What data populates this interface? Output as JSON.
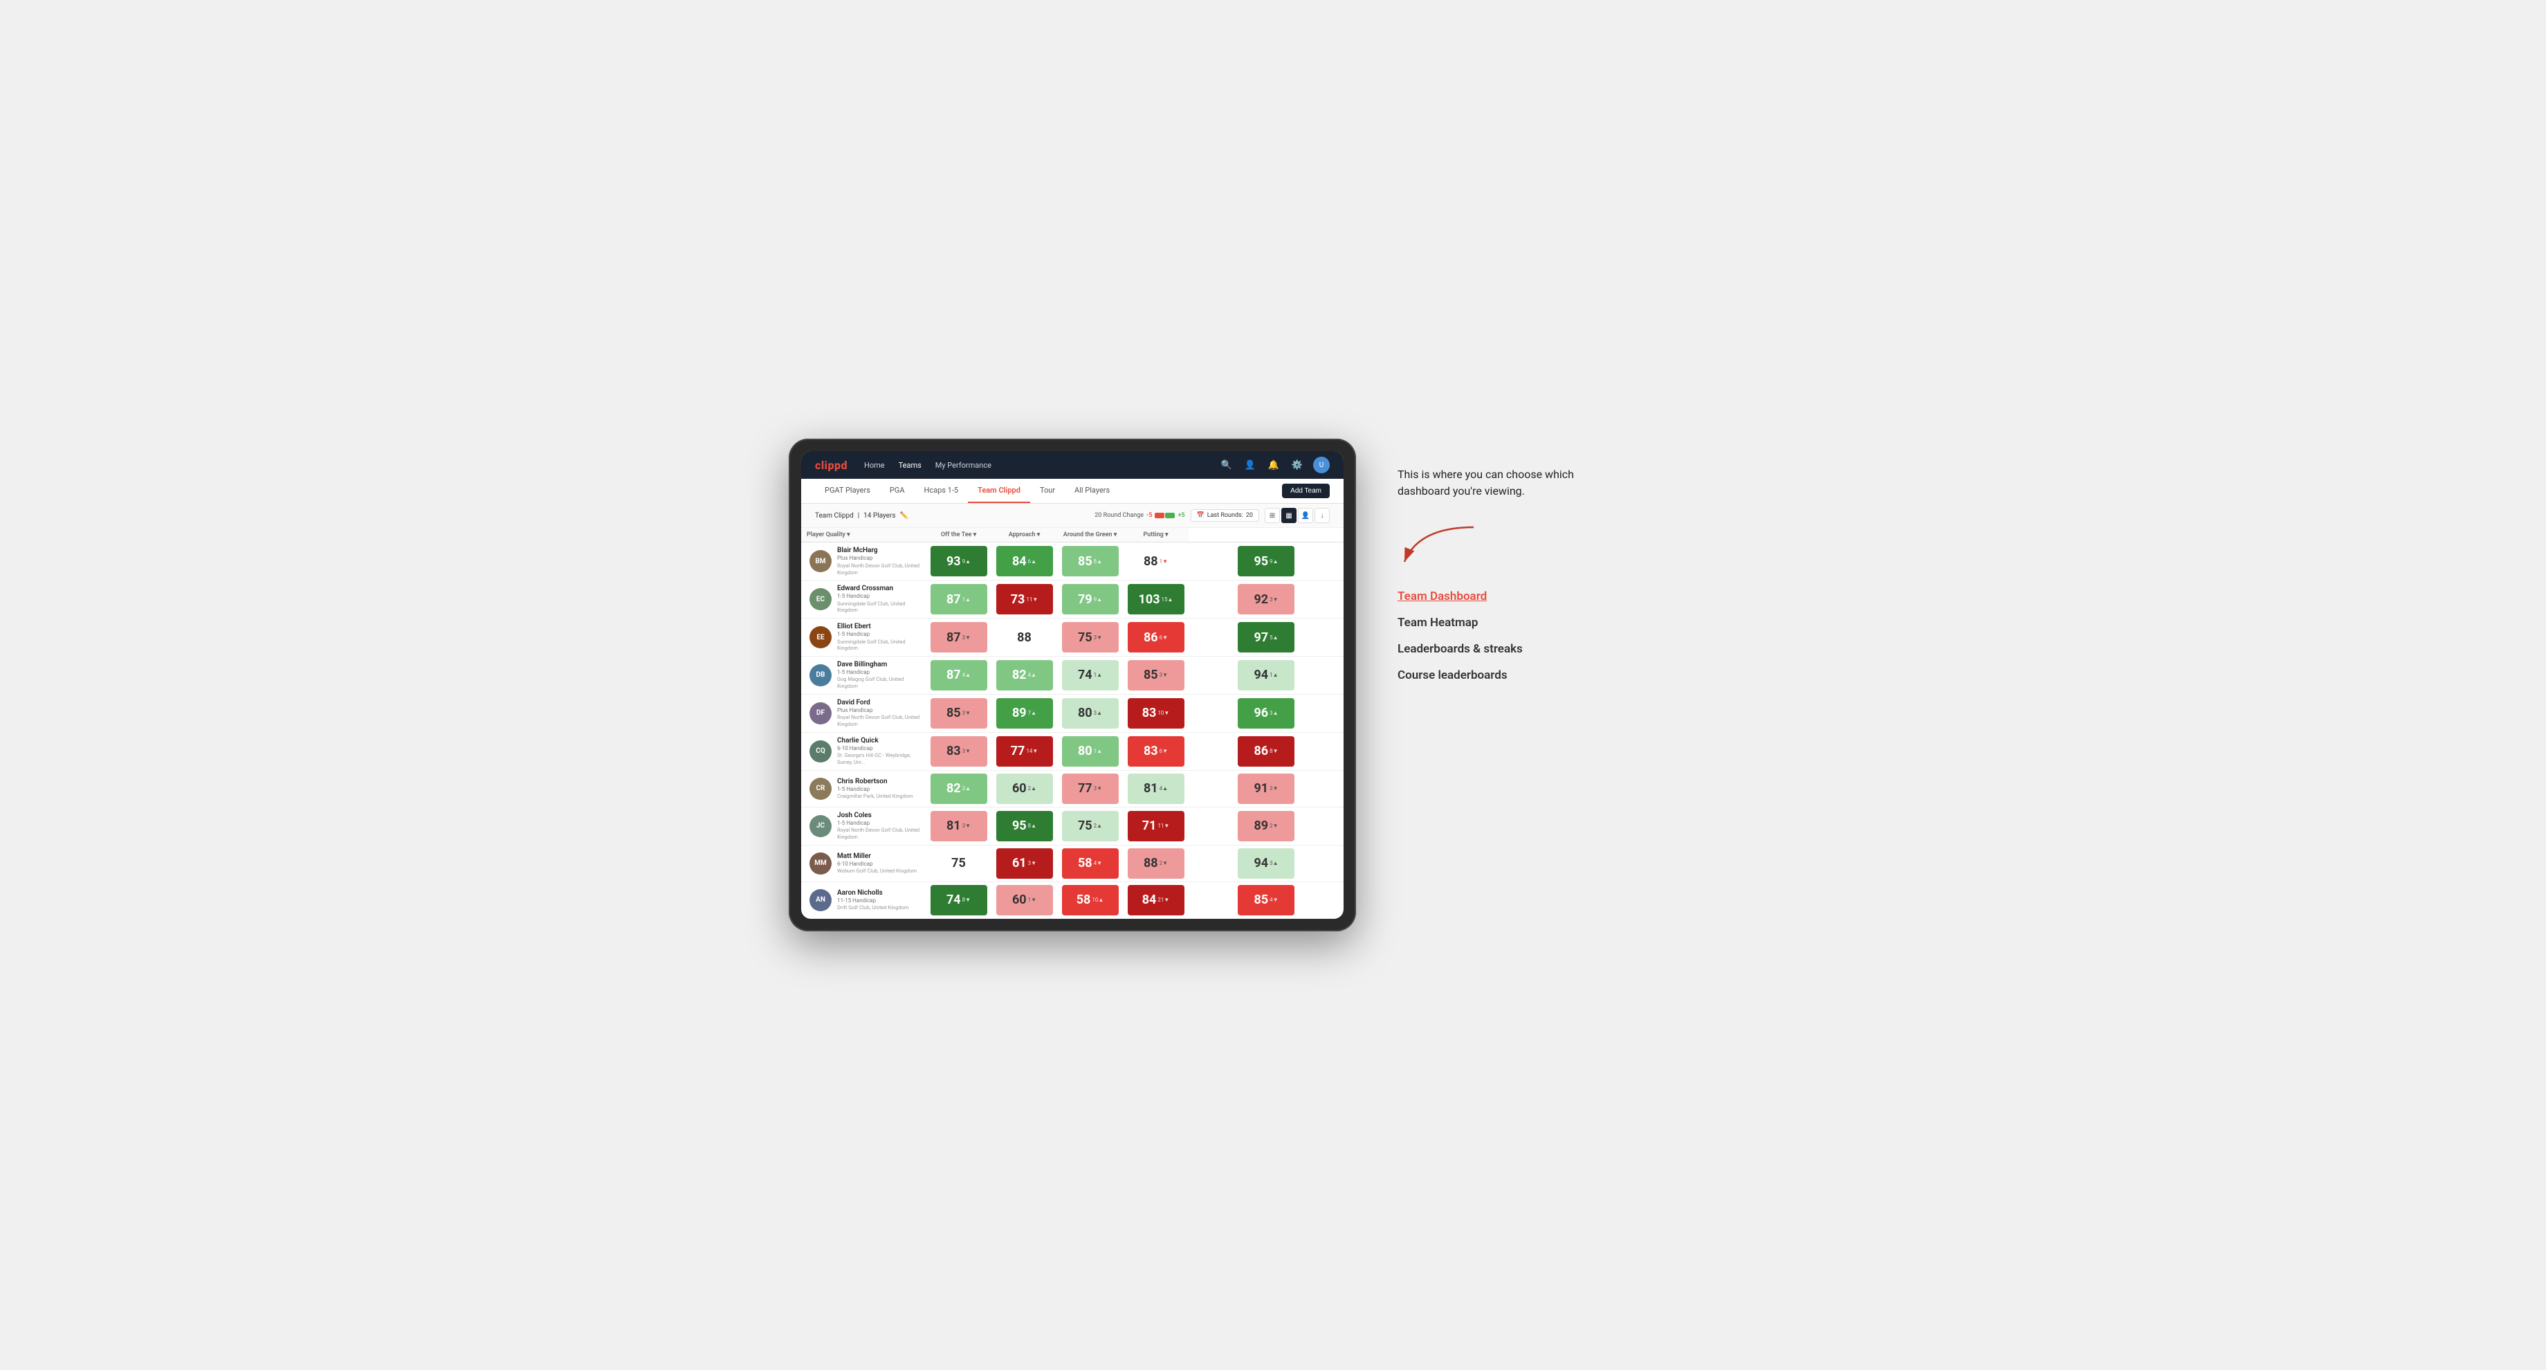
{
  "annotation": {
    "intro_text": "This is where you can choose which dashboard you're viewing.",
    "options": [
      {
        "id": "team-dashboard",
        "label": "Team Dashboard",
        "active": true
      },
      {
        "id": "team-heatmap",
        "label": "Team Heatmap",
        "active": false
      },
      {
        "id": "leaderboards",
        "label": "Leaderboards & streaks",
        "active": false
      },
      {
        "id": "course-leaderboards",
        "label": "Course leaderboards",
        "active": false
      }
    ]
  },
  "nav": {
    "logo": "clippd",
    "links": [
      {
        "id": "home",
        "label": "Home",
        "active": false
      },
      {
        "id": "teams",
        "label": "Teams",
        "active": true
      },
      {
        "id": "my-performance",
        "label": "My Performance",
        "active": false
      }
    ]
  },
  "sub_nav": {
    "tabs": [
      {
        "id": "pgat",
        "label": "PGAT Players",
        "active": false
      },
      {
        "id": "pga",
        "label": "PGA",
        "active": false
      },
      {
        "id": "hcaps",
        "label": "Hcaps 1-5",
        "active": false
      },
      {
        "id": "team-clippd",
        "label": "Team Clippd",
        "active": true
      },
      {
        "id": "tour",
        "label": "Tour",
        "active": false
      },
      {
        "id": "all-players",
        "label": "All Players",
        "active": false
      }
    ],
    "add_team_btn": "Add Team"
  },
  "team_header": {
    "team_name": "Team Clippd",
    "player_count": "14 Players",
    "round_change_label": "20 Round Change",
    "minus_5": "-5",
    "plus_5": "+5",
    "last_rounds_label": "Last Rounds:",
    "last_rounds_value": "20"
  },
  "table": {
    "col_headers": [
      {
        "id": "player-quality",
        "label": "Player Quality ▾"
      },
      {
        "id": "off-tee",
        "label": "Off the Tee ▾"
      },
      {
        "id": "approach",
        "label": "Approach ▾"
      },
      {
        "id": "around-green",
        "label": "Around the Green ▾"
      },
      {
        "id": "putting",
        "label": "Putting ▾"
      }
    ],
    "players": [
      {
        "id": "blair-mcharg",
        "name": "Blair McHarg",
        "handicap": "Plus Handicap",
        "club": "Royal North Devon Golf Club, United Kingdom",
        "avatar_initials": "BM",
        "avatar_color": "#8B7355",
        "scores": [
          {
            "value": "93",
            "change": "9",
            "direction": "up",
            "bg": "strong-green"
          },
          {
            "value": "84",
            "change": "6",
            "direction": "up",
            "bg": "med-green"
          },
          {
            "value": "85",
            "change": "8",
            "direction": "up",
            "bg": "light-green"
          },
          {
            "value": "88",
            "change": "1",
            "direction": "down",
            "bg": "white"
          },
          {
            "value": "95",
            "change": "9",
            "direction": "up",
            "bg": "strong-green"
          }
        ]
      },
      {
        "id": "edward-crossman",
        "name": "Edward Crossman",
        "handicap": "1-5 Handicap",
        "club": "Sunningdale Golf Club, United Kingdom",
        "avatar_initials": "EC",
        "avatar_color": "#6B8E6B",
        "scores": [
          {
            "value": "87",
            "change": "1",
            "direction": "up",
            "bg": "light-green"
          },
          {
            "value": "73",
            "change": "11",
            "direction": "down",
            "bg": "strong-red"
          },
          {
            "value": "79",
            "change": "9",
            "direction": "up",
            "bg": "light-green"
          },
          {
            "value": "103",
            "change": "15",
            "direction": "up",
            "bg": "strong-green"
          },
          {
            "value": "92",
            "change": "3",
            "direction": "down",
            "bg": "light-red"
          }
        ]
      },
      {
        "id": "elliot-ebert",
        "name": "Elliot Ebert",
        "handicap": "1-5 Handicap",
        "club": "Sunningdale Golf Club, United Kingdom",
        "avatar_initials": "EE",
        "avatar_color": "#8B4513",
        "scores": [
          {
            "value": "87",
            "change": "3",
            "direction": "down",
            "bg": "light-red"
          },
          {
            "value": "88",
            "change": "",
            "direction": "",
            "bg": "white"
          },
          {
            "value": "75",
            "change": "3",
            "direction": "down",
            "bg": "light-red"
          },
          {
            "value": "86",
            "change": "6",
            "direction": "down",
            "bg": "med-red"
          },
          {
            "value": "97",
            "change": "5",
            "direction": "up",
            "bg": "strong-green"
          }
        ]
      },
      {
        "id": "dave-billingham",
        "name": "Dave Billingham",
        "handicap": "1-5 Handicap",
        "club": "Gog Magog Golf Club, United Kingdom",
        "avatar_initials": "DB",
        "avatar_color": "#4A7C9E",
        "scores": [
          {
            "value": "87",
            "change": "4",
            "direction": "up",
            "bg": "light-green"
          },
          {
            "value": "82",
            "change": "4",
            "direction": "up",
            "bg": "light-green"
          },
          {
            "value": "74",
            "change": "1",
            "direction": "up",
            "bg": "very-light-green"
          },
          {
            "value": "85",
            "change": "3",
            "direction": "down",
            "bg": "light-red"
          },
          {
            "value": "94",
            "change": "1",
            "direction": "up",
            "bg": "very-light-green"
          }
        ]
      },
      {
        "id": "david-ford",
        "name": "David Ford",
        "handicap": "Plus Handicap",
        "club": "Royal North Devon Golf Club, United Kingdom",
        "avatar_initials": "DF",
        "avatar_color": "#7B6B8B",
        "scores": [
          {
            "value": "85",
            "change": "3",
            "direction": "down",
            "bg": "light-red"
          },
          {
            "value": "89",
            "change": "7",
            "direction": "up",
            "bg": "med-green"
          },
          {
            "value": "80",
            "change": "3",
            "direction": "up",
            "bg": "very-light-green"
          },
          {
            "value": "83",
            "change": "10",
            "direction": "down",
            "bg": "strong-red"
          },
          {
            "value": "96",
            "change": "3",
            "direction": "up",
            "bg": "med-green"
          }
        ]
      },
      {
        "id": "charlie-quick",
        "name": "Charlie Quick",
        "handicap": "6-10 Handicap",
        "club": "St. George's Hill GC - Weybridge, Surrey, Uni...",
        "avatar_initials": "CQ",
        "avatar_color": "#5B7B6B",
        "scores": [
          {
            "value": "83",
            "change": "3",
            "direction": "down",
            "bg": "light-red"
          },
          {
            "value": "77",
            "change": "14",
            "direction": "down",
            "bg": "strong-red"
          },
          {
            "value": "80",
            "change": "1",
            "direction": "up",
            "bg": "light-green"
          },
          {
            "value": "83",
            "change": "6",
            "direction": "down",
            "bg": "med-red"
          },
          {
            "value": "86",
            "change": "8",
            "direction": "down",
            "bg": "strong-red"
          }
        ]
      },
      {
        "id": "chris-robertson",
        "name": "Chris Robertson",
        "handicap": "1-5 Handicap",
        "club": "Craigmillar Park, United Kingdom",
        "avatar_initials": "CR",
        "avatar_color": "#8B7B5B",
        "scores": [
          {
            "value": "82",
            "change": "3",
            "direction": "up",
            "bg": "light-green"
          },
          {
            "value": "60",
            "change": "2",
            "direction": "up",
            "bg": "very-light-green"
          },
          {
            "value": "77",
            "change": "3",
            "direction": "down",
            "bg": "light-red"
          },
          {
            "value": "81",
            "change": "4",
            "direction": "up",
            "bg": "very-light-green"
          },
          {
            "value": "91",
            "change": "3",
            "direction": "down",
            "bg": "light-red"
          }
        ]
      },
      {
        "id": "josh-coles",
        "name": "Josh Coles",
        "handicap": "1-5 Handicap",
        "club": "Royal North Devon Golf Club, United Kingdom",
        "avatar_initials": "JC",
        "avatar_color": "#6B8B7B",
        "scores": [
          {
            "value": "81",
            "change": "3",
            "direction": "down",
            "bg": "light-red"
          },
          {
            "value": "95",
            "change": "8",
            "direction": "up",
            "bg": "strong-green"
          },
          {
            "value": "75",
            "change": "2",
            "direction": "up",
            "bg": "very-light-green"
          },
          {
            "value": "71",
            "change": "11",
            "direction": "down",
            "bg": "strong-red"
          },
          {
            "value": "89",
            "change": "2",
            "direction": "down",
            "bg": "light-red"
          }
        ]
      },
      {
        "id": "matt-miller",
        "name": "Matt Miller",
        "handicap": "6-10 Handicap",
        "club": "Woburn Golf Club, United Kingdom",
        "avatar_initials": "MM",
        "avatar_color": "#7B5B4B",
        "scores": [
          {
            "value": "75",
            "change": "",
            "direction": "",
            "bg": "white"
          },
          {
            "value": "61",
            "change": "3",
            "direction": "down",
            "bg": "strong-red"
          },
          {
            "value": "58",
            "change": "4",
            "direction": "down",
            "bg": "med-red"
          },
          {
            "value": "88",
            "change": "2",
            "direction": "down",
            "bg": "light-red"
          },
          {
            "value": "94",
            "change": "3",
            "direction": "up",
            "bg": "very-light-green"
          }
        ]
      },
      {
        "id": "aaron-nicholls",
        "name": "Aaron Nicholls",
        "handicap": "11-15 Handicap",
        "club": "Drift Golf Club, United Kingdom",
        "avatar_initials": "AN",
        "avatar_color": "#5B6B8B",
        "scores": [
          {
            "value": "74",
            "change": "8",
            "direction": "down",
            "bg": "strong-green"
          },
          {
            "value": "60",
            "change": "1",
            "direction": "down",
            "bg": "light-red"
          },
          {
            "value": "58",
            "change": "10",
            "direction": "up",
            "bg": "med-red"
          },
          {
            "value": "84",
            "change": "21",
            "direction": "down",
            "bg": "strong-red"
          },
          {
            "value": "85",
            "change": "4",
            "direction": "down",
            "bg": "med-red"
          }
        ]
      }
    ]
  }
}
